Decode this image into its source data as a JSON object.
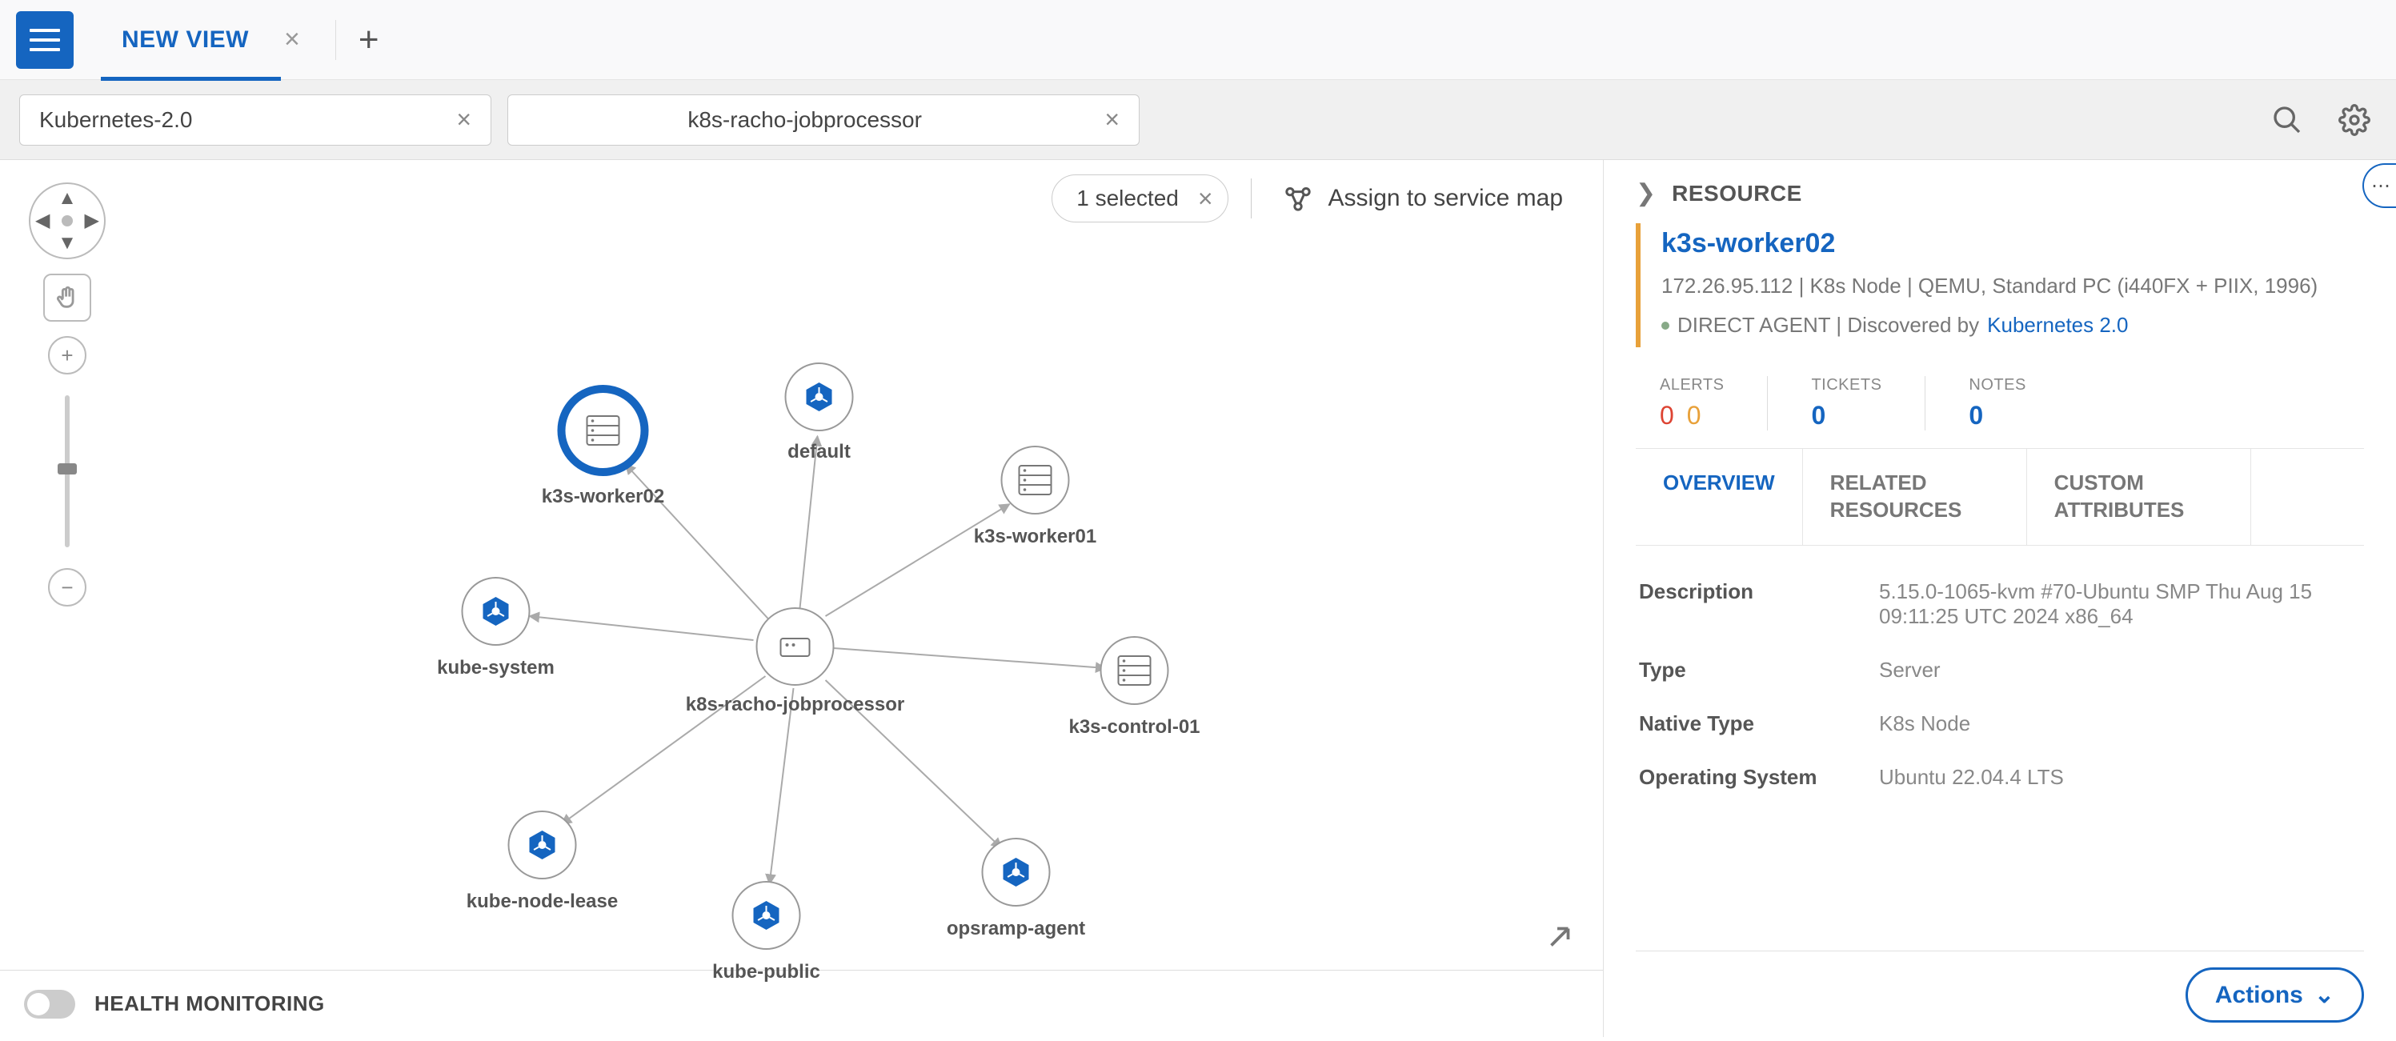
{
  "topbar": {
    "tab_label": "NEW VIEW"
  },
  "filters": {
    "chip1": "Kubernetes-2.0",
    "chip2": "k8s-racho-jobprocessor"
  },
  "canvas": {
    "selected_text": "1 selected",
    "assign_label": "Assign to service map",
    "health_label": "HEALTH MONITORING",
    "nodes": {
      "center": "k8s-racho-jobprocessor",
      "worker02": "k3s-worker02",
      "default": "default",
      "worker01": "k3s-worker01",
      "control01": "k3s-control-01",
      "opsramp": "opsramp-agent",
      "kubepublic": "kube-public",
      "kubenodelease": "kube-node-lease",
      "kubesystem": "kube-system"
    }
  },
  "panel": {
    "header": "RESOURCE",
    "name": "k3s-worker02",
    "subtitle": "172.26.95.112 | K8s Node | QEMU, Standard PC (i440FX + PIIX, 1996)",
    "disc_prefix": "DIRECT AGENT | Discovered by ",
    "disc_link": "Kubernetes 2.0",
    "stats": {
      "alerts_label": "ALERTS",
      "alerts_a": "0",
      "alerts_b": "0",
      "tickets_label": "TICKETS",
      "tickets": "0",
      "notes_label": "NOTES",
      "notes": "0"
    },
    "tabs": {
      "overview": "OVERVIEW",
      "related": "RELATED RESOURCES",
      "custom": "CUSTOM ATTRIBUTES"
    },
    "props": {
      "desc_k": "Description",
      "desc_v": "5.15.0-1065-kvm #70-Ubuntu SMP Thu Aug 15 09:11:25 UTC 2024 x86_64",
      "type_k": "Type",
      "type_v": "Server",
      "native_k": "Native Type",
      "native_v": "K8s Node",
      "os_k": "Operating System",
      "os_v": "Ubuntu 22.04.4 LTS"
    },
    "actions": "Actions"
  }
}
